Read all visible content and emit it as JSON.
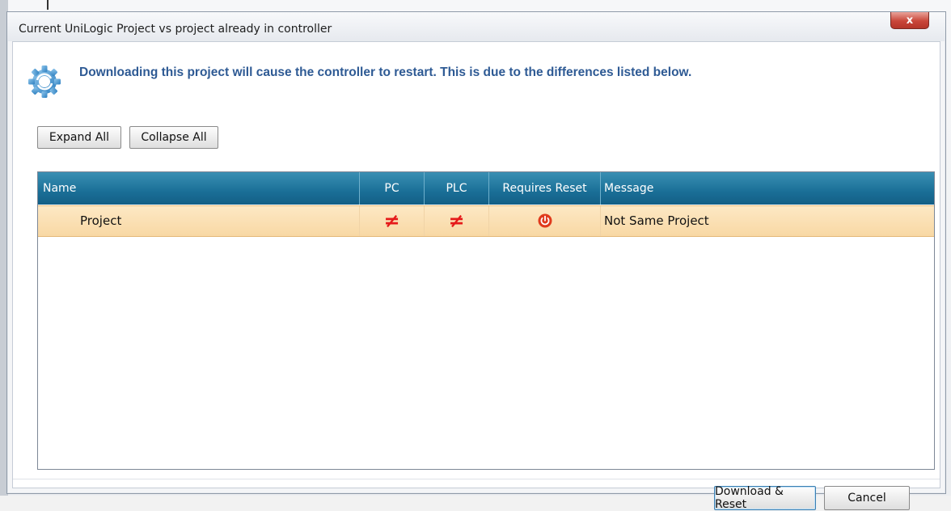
{
  "window": {
    "title": "Current UniLogic Project vs project already in controller",
    "close_label": "x"
  },
  "info": {
    "icon": "gear-sync-icon",
    "message": "Downloading this project will cause the controller to restart. This is due to the differences listed below."
  },
  "toolbar": {
    "expand_all": "Expand All",
    "collapse_all": "Collapse All"
  },
  "grid": {
    "columns": [
      "Name",
      "PC",
      "PLC",
      "Requires Reset",
      "Message"
    ],
    "rows": [
      {
        "name": "Project",
        "pc": "≠",
        "plc": "≠",
        "requires_reset_icon": "power-icon",
        "message": "Not Same Project"
      }
    ],
    "colors": {
      "header": "#1a6f97",
      "selected_row": "#f8d8a4",
      "diff_symbol": "#e51a1a"
    }
  },
  "footer": {
    "download_reset": "Download & Reset",
    "cancel": "Cancel"
  }
}
